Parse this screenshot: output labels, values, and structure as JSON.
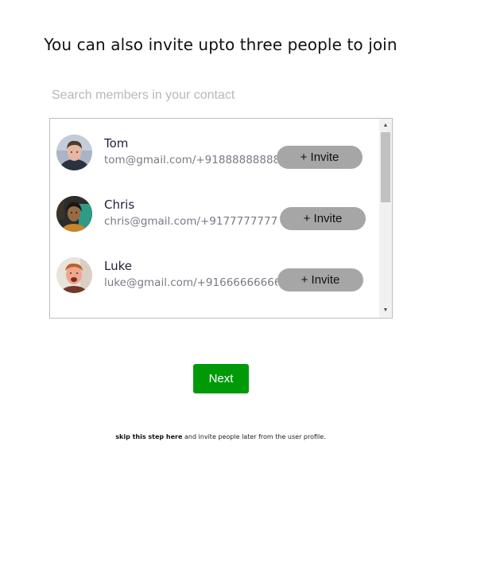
{
  "title": "You can also invite upto three people to join",
  "search": {
    "placeholder": "Search members in your contact",
    "value": ""
  },
  "contacts": [
    {
      "name": "Tom",
      "contact": "tom@gmail.com/+918888888888",
      "invite_label": "+ Invite",
      "avatar_icon": "avatar-photo"
    },
    {
      "name": "Chris",
      "contact": "chris@gmail.com/+917777777777",
      "invite_label": "+ Invite",
      "avatar_icon": "avatar-photo"
    },
    {
      "name": "Luke",
      "contact": "luke@gmail.com/+916666666666",
      "invite_label": "+ Invite",
      "avatar_icon": "avatar-photo"
    }
  ],
  "next_label": "Next",
  "skip": {
    "link_text": "skip this step here",
    "rest_text": " and invite people later from the user profile."
  },
  "colors": {
    "next_button": "#009a09",
    "invite_button": "#a6a6a6"
  }
}
